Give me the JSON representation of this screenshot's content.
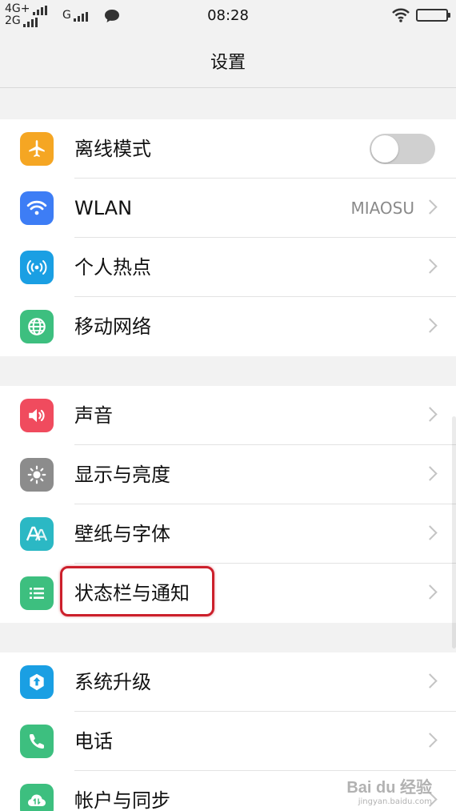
{
  "status_bar": {
    "net1": "4G+",
    "net2": "2G",
    "net3": "G",
    "time": "08:28"
  },
  "header": {
    "title": "设置"
  },
  "groups": [
    {
      "items": [
        {
          "label": "离线模式",
          "icon": "airplane-icon",
          "icon_color": "#f5a623",
          "control": "toggle",
          "toggle_on": false
        },
        {
          "label": "WLAN",
          "icon": "wifi-icon",
          "icon_color": "#3d7df5",
          "value": "MIAOSU"
        },
        {
          "label": "个人热点",
          "icon": "hotspot-icon",
          "icon_color": "#1a9fe3"
        },
        {
          "label": "移动网络",
          "icon": "globe-icon",
          "icon_color": "#3dbf7f"
        }
      ]
    },
    {
      "items": [
        {
          "label": "声音",
          "icon": "speaker-icon",
          "icon_color": "#f04b5e"
        },
        {
          "label": "显示与亮度",
          "icon": "brightness-icon",
          "icon_color": "#8c8c8c"
        },
        {
          "label": "壁纸与字体",
          "icon": "font-icon",
          "icon_color": "#2bb8c4"
        },
        {
          "label": "状态栏与通知",
          "icon": "list-icon",
          "icon_color": "#3dbf7f",
          "highlighted": true
        }
      ]
    },
    {
      "items": [
        {
          "label": "系统升级",
          "icon": "update-icon",
          "icon_color": "#1a9fe3"
        },
        {
          "label": "电话",
          "icon": "phone-icon",
          "icon_color": "#3dbf7f"
        },
        {
          "label": "帐户与同步",
          "icon": "cloud-sync-icon",
          "icon_color": "#3dbf7f"
        }
      ]
    }
  ],
  "watermark": {
    "main": "Bai du 经验",
    "sub": "jingyan.baidu.com"
  }
}
